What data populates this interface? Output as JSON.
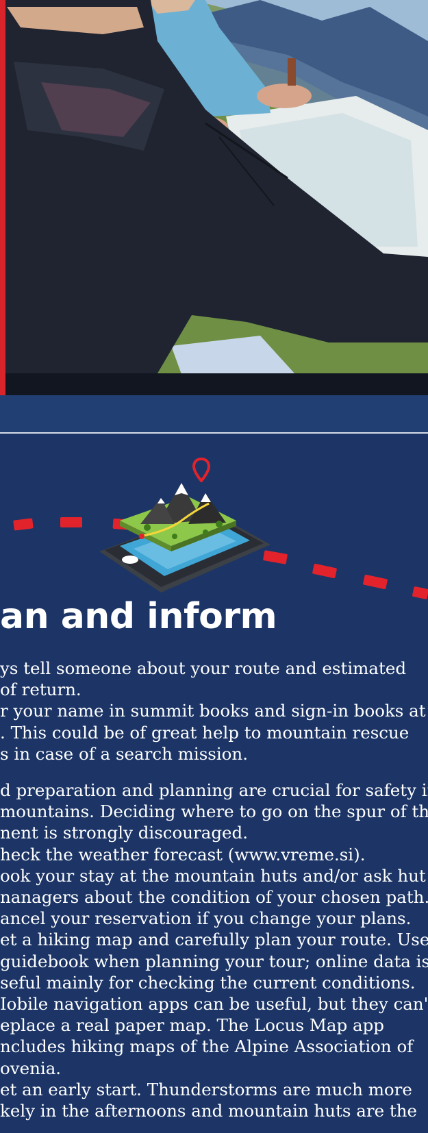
{
  "heading": "an and inform",
  "paragraphs": [
    {
      "lines": [
        "ys tell someone about your route and estimated",
        "of return.",
        "r your name in summit books and sign-in books at",
        ". This could be of great help to mountain rescue",
        "s in case of a search mission."
      ]
    },
    {
      "lines": [
        "d preparation and planning are crucial for safety in",
        "mountains. Deciding where to go on the spur of the",
        "nent is strongly discouraged.",
        "heck the weather forecast (www.vreme.si).",
        "ook your stay at the mountain huts and/or ask hut",
        "nanagers about the condition of your chosen path.",
        "ancel your reservation if you change your plans.",
        "et a hiking map and carefully plan your route. Use",
        "guidebook when planning your tour; online data is",
        "seful mainly for checking the current conditions.",
        "Iobile navigation apps can be useful, but they can't",
        "eplace a real paper map. The Locus Map app",
        "ncludes hiking maps of the Alpine Association of",
        "ovenia.",
        "et an early start. Thunderstorms are much more",
        "kely in the afternoons and mountain huts are the"
      ]
    }
  ],
  "icons": {
    "illustration": "phone-map-mountain-icon",
    "pin": "location-pin-icon"
  },
  "colors": {
    "background": "#1c3566",
    "accent": "#e3232c",
    "text": "#ffffff"
  }
}
